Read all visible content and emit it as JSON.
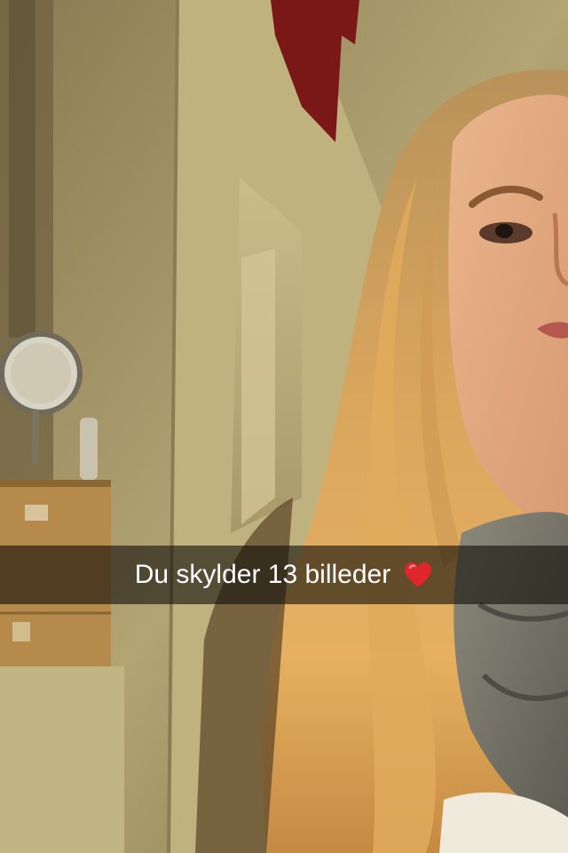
{
  "snap": {
    "caption": "Du skylder 13 billeder",
    "caption_emoji": "red-heart",
    "caption_emoji_color": "#e0262b"
  }
}
